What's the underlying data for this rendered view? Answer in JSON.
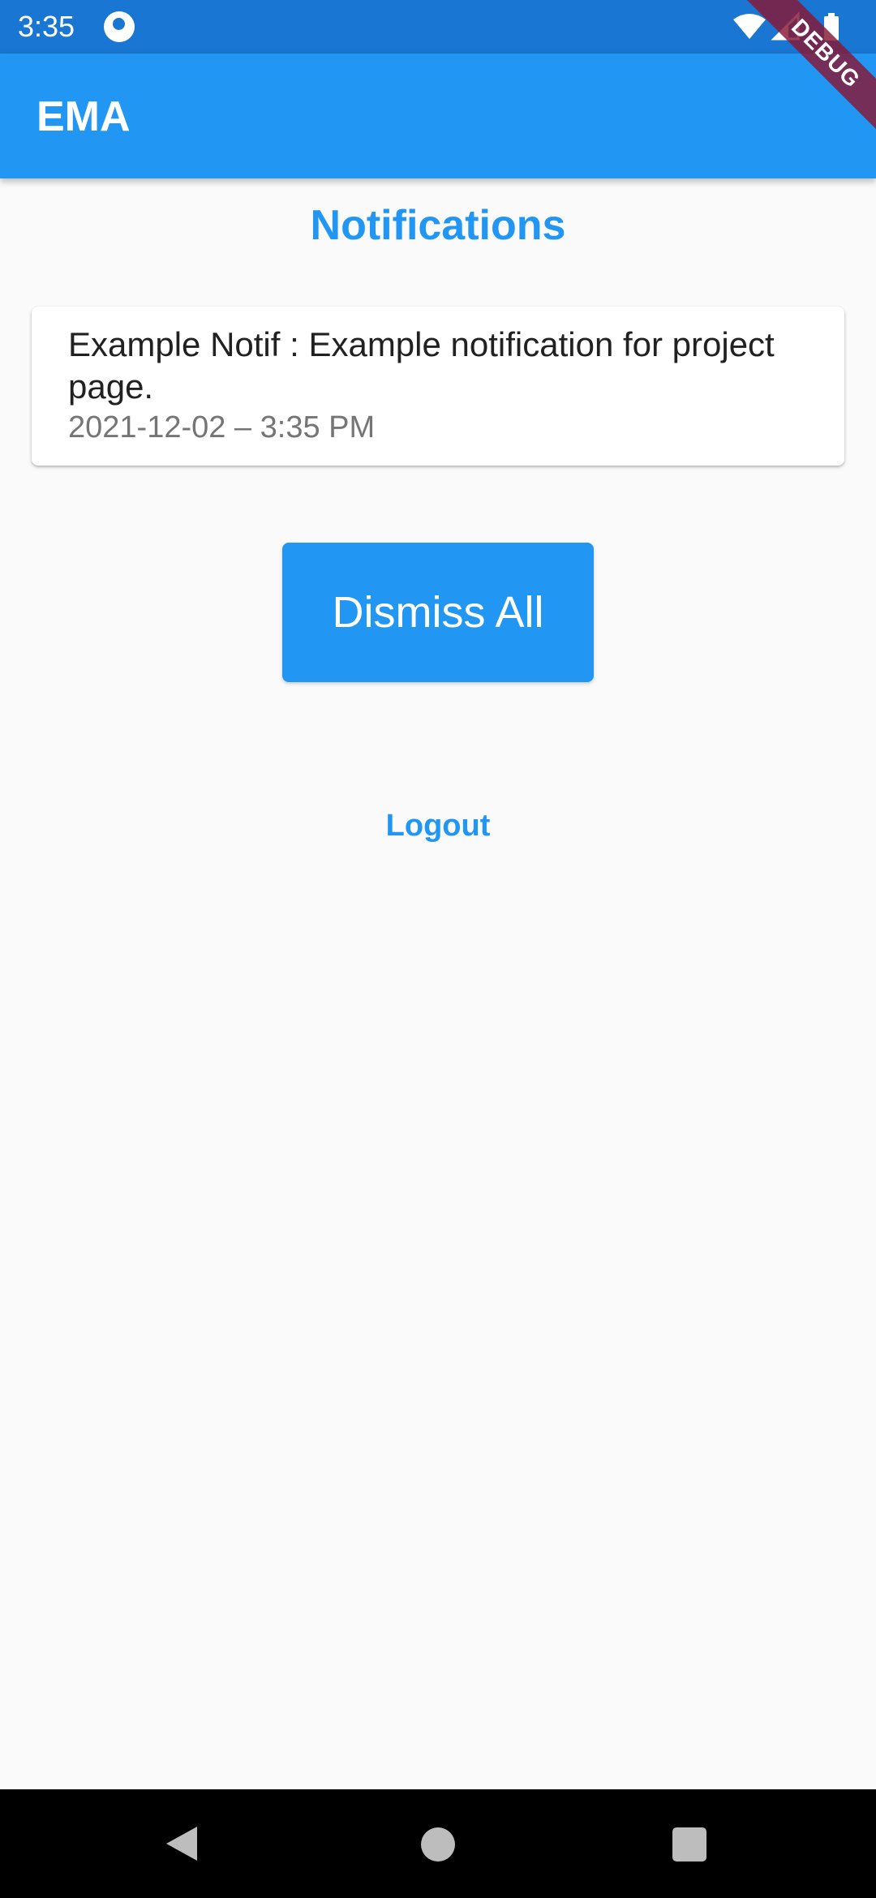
{
  "status_bar": {
    "time": "3:35",
    "app_icon": "notification-app-icon",
    "icons": [
      "wifi-icon",
      "cellular-signal-icon",
      "battery-icon"
    ]
  },
  "debug_banner": {
    "label": "DEBUG"
  },
  "app_bar": {
    "title": "EMA"
  },
  "page": {
    "title": "Notifications"
  },
  "notifications": [
    {
      "text": "Example Notif : Example notification for project page.",
      "timestamp": "2021-12-02 – 3:35 PM"
    }
  ],
  "actions": {
    "dismiss_all_label": "Dismiss All",
    "logout_label": "Logout"
  },
  "nav_bar": {
    "icons": [
      "back-icon",
      "home-icon",
      "recents-icon"
    ]
  },
  "colors": {
    "primary": "#2196f3",
    "status_bar": "#1976d2",
    "background": "#fafafa",
    "debug_banner": "#881734"
  }
}
